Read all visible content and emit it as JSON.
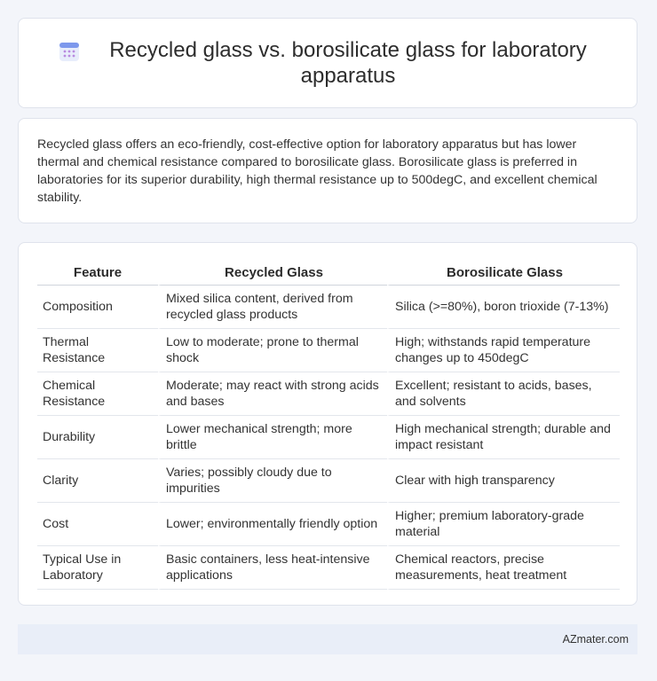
{
  "header": {
    "title": "Recycled glass vs. borosilicate glass for laboratory apparatus",
    "icon": "calendar-icon",
    "accent_color": "#6f8de8"
  },
  "summary": {
    "text": "Recycled glass offers an eco-friendly, cost-effective option for laboratory apparatus but has lower thermal and chemical resistance compared to borosilicate glass. Borosilicate glass is preferred in laboratories for its superior durability, high thermal resistance up to 500degC, and excellent chemical stability."
  },
  "table": {
    "headers": [
      "Feature",
      "Recycled Glass",
      "Borosilicate Glass"
    ],
    "rows": [
      [
        "Composition",
        "Mixed silica content, derived from recycled glass products",
        "Silica (>=80%), boron trioxide (7-13%)"
      ],
      [
        "Thermal Resistance",
        "Low to moderate; prone to thermal shock",
        "High; withstands rapid temperature changes up to 450degC"
      ],
      [
        "Chemical Resistance",
        "Moderate; may react with strong acids and bases",
        "Excellent; resistant to acids, bases, and solvents"
      ],
      [
        "Durability",
        "Lower mechanical strength; more brittle",
        "High mechanical strength; durable and impact resistant"
      ],
      [
        "Clarity",
        "Varies; possibly cloudy due to impurities",
        "Clear with high transparency"
      ],
      [
        "Cost",
        "Lower; environmentally friendly option",
        "Higher; premium laboratory-grade material"
      ],
      [
        "Typical Use in Laboratory",
        "Basic containers, less heat-intensive applications",
        "Chemical reactors, precise measurements, heat treatment"
      ]
    ]
  },
  "footer": {
    "brand": "AZmater.com"
  }
}
